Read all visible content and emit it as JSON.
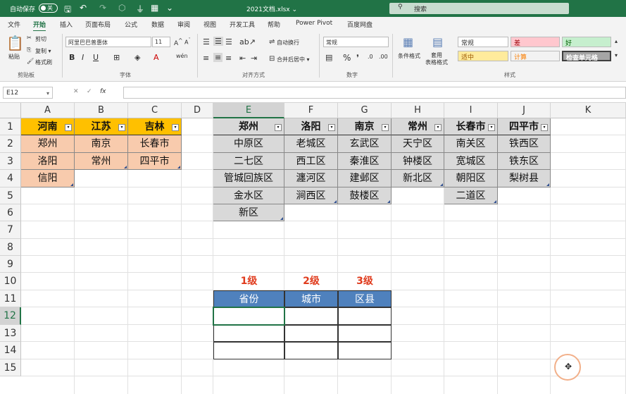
{
  "titlebar": {
    "autosave_label": "自动保存",
    "autosave_state": "关",
    "doc_title": "2021文档.xlsx ⌄",
    "search_placeholder": "搜索"
  },
  "ribbon_tabs": [
    "文件",
    "开始",
    "插入",
    "页面布局",
    "公式",
    "数据",
    "审阅",
    "视图",
    "开发工具",
    "帮助",
    "Power Pivot",
    "百度网盘"
  ],
  "active_tab": "开始",
  "ribbon": {
    "clipboard": {
      "paste": "粘贴",
      "cut": "剪切",
      "copy": "复制 ▾",
      "format_painter": "格式刷",
      "label": "剪贴板"
    },
    "font": {
      "name": "阿里巴巴普惠体",
      "size": "11",
      "label": "字体"
    },
    "alignment": {
      "wrap": "自动换行",
      "merge": "合并后居中 ▾",
      "label": "对齐方式"
    },
    "number": {
      "format": "常规",
      "label": "数字"
    },
    "styles": {
      "conditional": "条件格式",
      "table": "套用\n表格格式",
      "normal": "常规",
      "bad": "差",
      "good": "好",
      "neutral": "适中",
      "calc": "计算",
      "check": "检查单元格",
      "label": "样式",
      "colors": {
        "normal": "#ffffff",
        "bad": "#ffc7ce",
        "good": "#c6efce",
        "neutral": "#ffeb9c",
        "calc": "#f2f2f2",
        "check": "#a5a5a5"
      }
    }
  },
  "formula_bar": {
    "name_box": "E12",
    "formula": ""
  },
  "columns": [
    "A",
    "B",
    "C",
    "D",
    "E",
    "F",
    "G",
    "H",
    "I",
    "J",
    "K"
  ],
  "selected_column": "E",
  "rows": [
    "1",
    "2",
    "3",
    "4",
    "5",
    "6",
    "7",
    "8",
    "9",
    "10",
    "11",
    "12",
    "13",
    "14",
    "15"
  ],
  "selected_row": "12",
  "province_table": {
    "headers": [
      "河南",
      "江苏",
      "吉林"
    ],
    "columns": [
      [
        "郑州",
        "洛阳",
        "信阳"
      ],
      [
        "南京",
        "常州"
      ],
      [
        "长春市",
        "四平市"
      ]
    ]
  },
  "city_table": {
    "headers": [
      "郑州",
      "洛阳",
      "南京",
      "常州",
      "长春市",
      "四平市"
    ],
    "columns": [
      [
        "中原区",
        "二七区",
        "管城回族区",
        "金水区",
        "新区"
      ],
      [
        "老城区",
        "西工区",
        "瀍河区",
        "涧西区"
      ],
      [
        "玄武区",
        "秦淮区",
        "建邺区",
        "鼓楼区"
      ],
      [
        "天宁区",
        "钟楼区",
        "新北区"
      ],
      [
        "南关区",
        "宽城区",
        "朝阳区",
        "二道区"
      ],
      [
        "铁西区",
        "铁东区",
        "梨树县"
      ]
    ]
  },
  "levels": [
    "1级",
    "2级",
    "3级"
  ],
  "input_table": {
    "headers": [
      "省份",
      "城市",
      "区县"
    ]
  },
  "colors": {
    "accent": "#217346",
    "header_orange": "#ffc000",
    "body_orange": "#f8cbad",
    "gray": "#d9d9d9",
    "blue": "#4f81bd",
    "level_red": "#e03c1e"
  }
}
